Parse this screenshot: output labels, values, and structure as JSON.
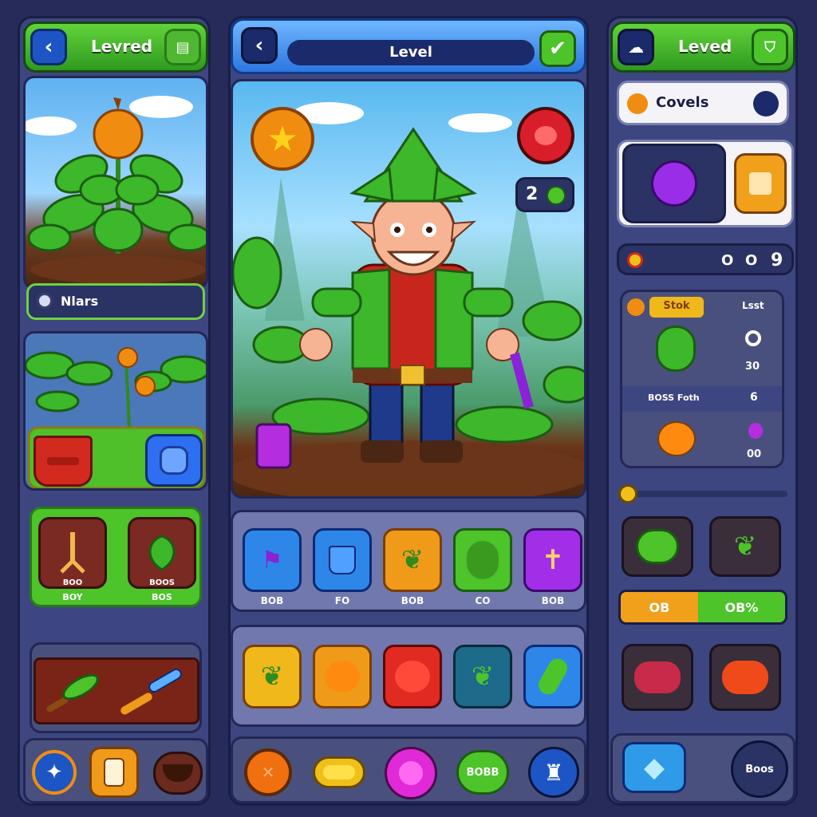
{
  "left": {
    "title": "Levred",
    "plant_field": "Nlars",
    "tool_tiles": [
      {
        "line1": "BOO",
        "line2": "BOY"
      },
      {
        "line1": "BOOS",
        "line2": "BOS"
      }
    ]
  },
  "middle": {
    "title": "Level",
    "counter": "2",
    "row1": [
      "BOB",
      "FO",
      "BOB",
      "CO",
      "BOB"
    ]
  },
  "right": {
    "title": "Leved",
    "search_label": "Covels",
    "stats": {
      "tab": "Stok",
      "col_label": "Lsst",
      "value1": "30",
      "mid_label": "BOSS Foth",
      "mid_value": "6",
      "value2": "00"
    },
    "toolbar_nums": [
      "O",
      "O",
      "9"
    ],
    "progress_left": "OB",
    "progress_right": "OB%",
    "boos_button": "Boos"
  },
  "bottom_mid": {
    "badge": "BOBB"
  },
  "colors": {
    "green": "#3fb52a",
    "blue": "#2a77e0",
    "panel": "#3d4680",
    "orange": "#ff9a1a"
  }
}
